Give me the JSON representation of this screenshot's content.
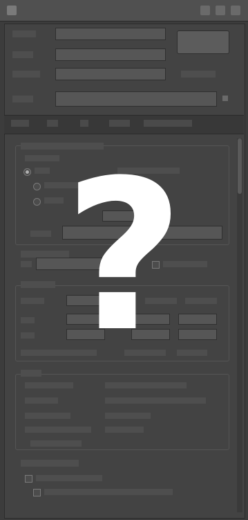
{
  "titlebar": {
    "icon": "window-icon",
    "title": "",
    "buttons": [
      "minimize-icon",
      "maximize-icon",
      "close-icon"
    ]
  },
  "overlay": {
    "glyph": "?"
  },
  "colors": {
    "background": "#3c3c3c",
    "panel": "#434343",
    "overlay_glyph": "#ffffff"
  }
}
